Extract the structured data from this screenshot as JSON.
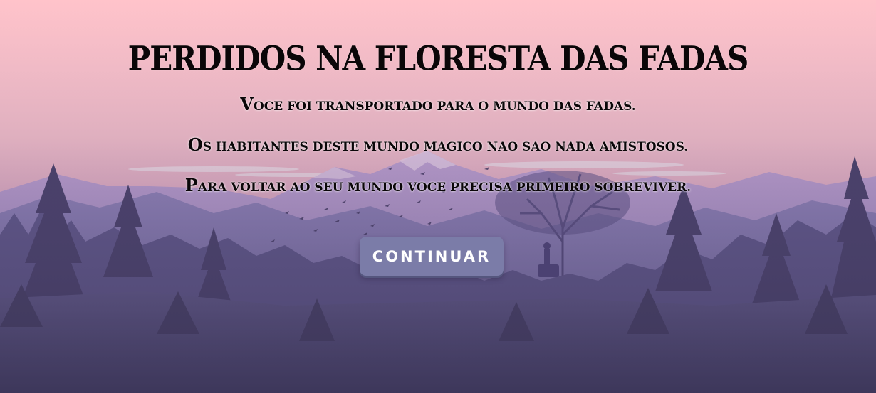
{
  "game": {
    "title": "PERDIDOS NA FLORESTA DAS FADAS",
    "intro_lines": [
      "Voce foi transportado para o mundo das fadas.",
      "Os habitantes deste mundo magico nao sao nada amistosos.",
      "Para voltar ao seu mundo voce precisa primeiro sobreviver."
    ],
    "continue_label": "Continuar"
  },
  "colors": {
    "sky_top": "#ffc4cb",
    "sky_bottom": "#e6a9c0",
    "button": "#7b7ca8",
    "text": "#0a0608"
  },
  "icons": {
    "background": "forest-mountain-landscape-illustration"
  }
}
